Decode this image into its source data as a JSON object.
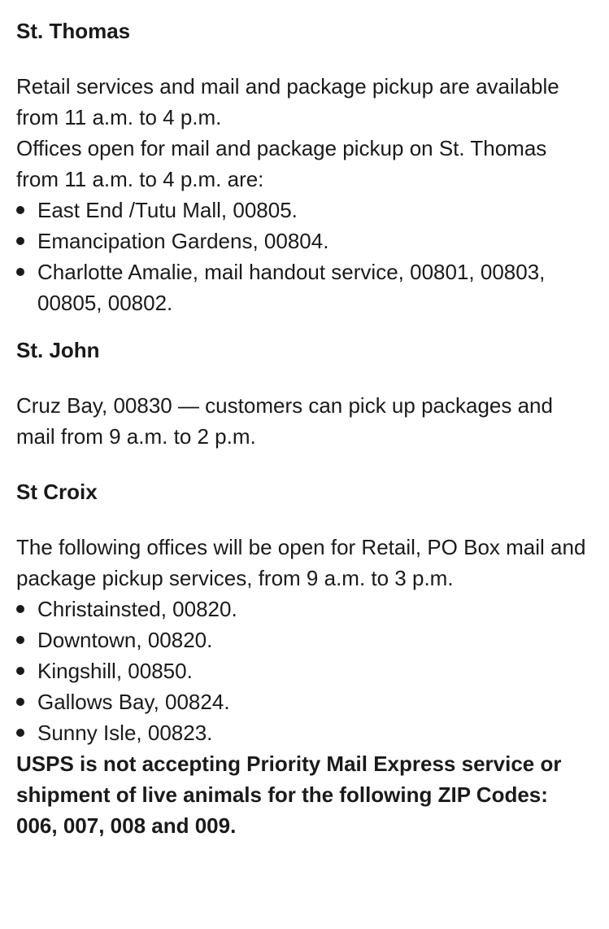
{
  "sections": {
    "st_thomas": {
      "heading": "St. Thomas",
      "line1": "Retail services and mail and package pickup are available from 11 a.m. to 4 p.m.",
      "line2": "Offices open for mail and package pickup on St. Thomas from 11 a.m. to 4 p.m. are:",
      "items": [
        "East End /Tutu Mall, 00805.",
        "Emancipation Gardens, 00804.",
        "Charlotte Amalie, mail handout service, 00801, 00803, 00805, 00802."
      ]
    },
    "st_john": {
      "heading": "St. John",
      "text": "Cruz Bay, 00830 — customers can pick up packages and mail from 9 a.m. to 2 p.m."
    },
    "st_croix": {
      "heading": "St Croix",
      "text": "The following offices will be open for Retail, PO Box mail and package pickup services, from 9 a.m. to 3 p.m.",
      "items": [
        "Christainsted, 00820.",
        "Downtown, 00820.",
        "Kingshill, 00850.",
        "Gallows Bay, 00824.",
        "Sunny Isle, 00823."
      ]
    }
  },
  "notice": "USPS is not accepting Priority Mail Express service or shipment of live animals for the following ZIP Codes: 006, 007, 008 and 009."
}
